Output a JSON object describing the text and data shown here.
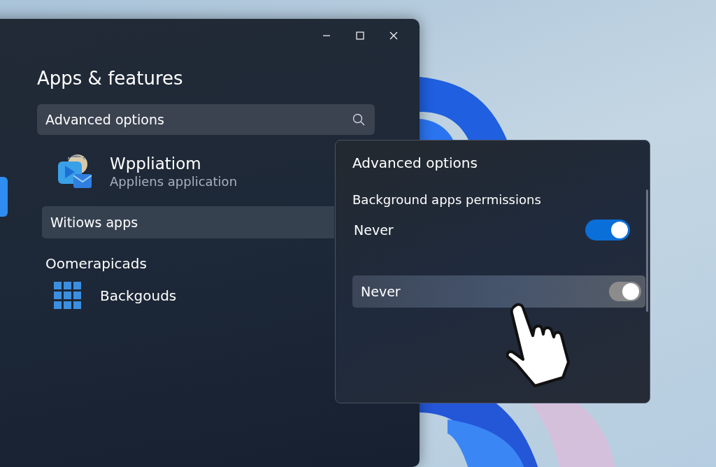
{
  "window": {
    "title": "Apps & features",
    "search": {
      "value": "Advanced options"
    },
    "app": {
      "name": "Wppliatiom",
      "subtitle": "Appliens application"
    },
    "list_item": {
      "label": "Witiows apps"
    },
    "section": {
      "heading": "Oomerapicads",
      "items": [
        {
          "label": "Backgouds"
        }
      ]
    }
  },
  "popup": {
    "title": "Advanced options",
    "subtitle": "Background apps permissions",
    "options": [
      {
        "label": "Never",
        "on": true,
        "hovered": false
      },
      {
        "label": "Never",
        "on": true,
        "disabled": true,
        "hovered": true
      }
    ]
  }
}
